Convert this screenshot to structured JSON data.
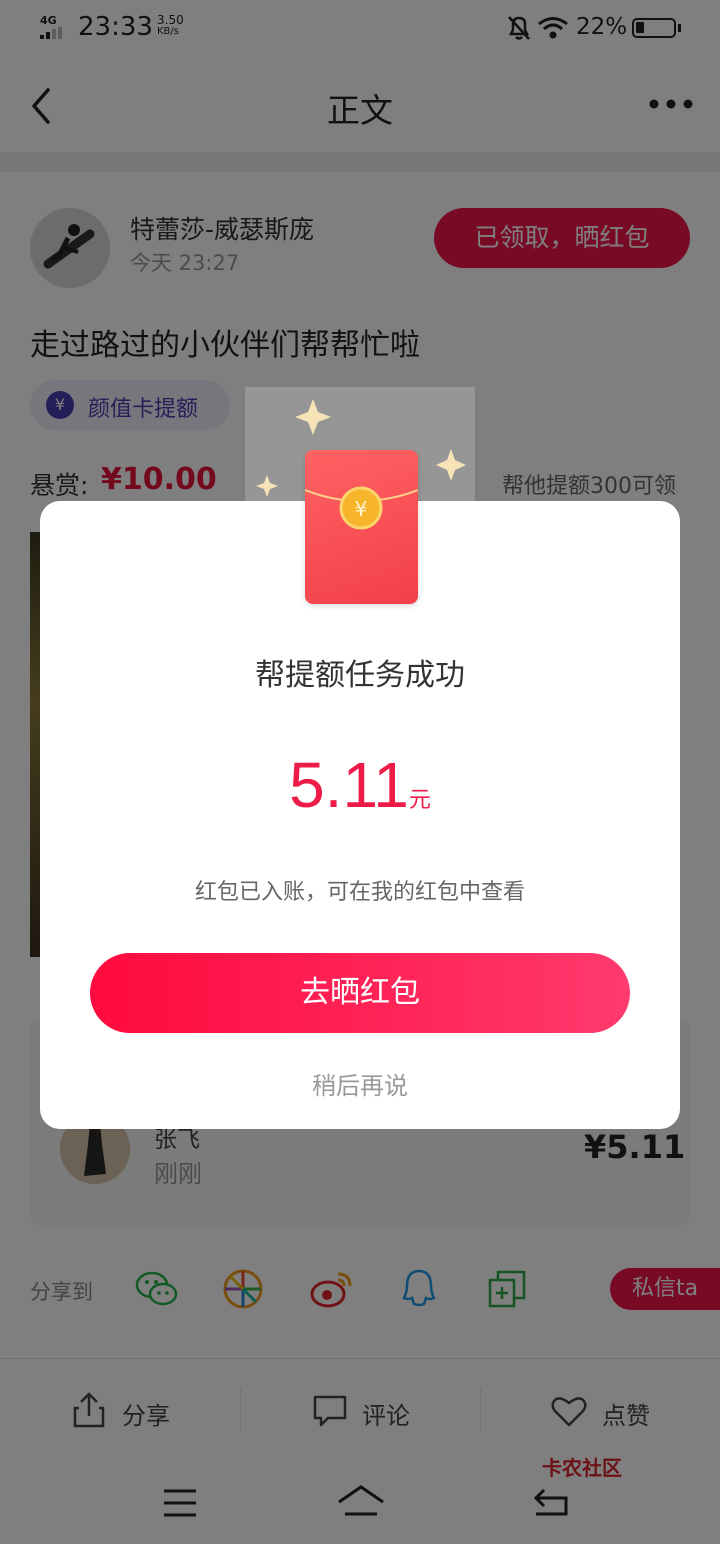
{
  "status_bar": {
    "network": "4G",
    "time": "23:33",
    "speed_value": "3.50",
    "speed_unit": "KB/s",
    "battery": "22%"
  },
  "header": {
    "title": "正文"
  },
  "post": {
    "author": "特蕾莎-威瑟斯庞",
    "time": "今天 23:27",
    "claim_button": "已领取，晒红包",
    "title": "走过路过的小伙伴们帮帮忙啦",
    "tag": "颜值卡提额",
    "bounty_label": "悬赏:",
    "bounty_value": "¥10.00",
    "bounty_note": "帮他提额300可领"
  },
  "helper": {
    "name": "张飞",
    "time": "刚刚",
    "amount": "¥5.11"
  },
  "share": {
    "label": "分享到",
    "icons": [
      "wechat-icon",
      "moments-icon",
      "weibo-icon",
      "qq-icon",
      "copy-icon"
    ],
    "dm_button": "私信ta"
  },
  "action_bar": {
    "share": "分享",
    "comment": "评论",
    "like": "点赞"
  },
  "watermark": "卡农社区",
  "modal": {
    "title": "帮提额任务成功",
    "amount": "5.11",
    "unit": "元",
    "description": "红包已入账，可在我的红包中查看",
    "primary_button": "去晒红包",
    "secondary_link": "稍后再说"
  },
  "colors": {
    "accent": "#ee1b49",
    "button_gradient_start": "#ff0a3e",
    "button_gradient_end": "#ff3a6d"
  }
}
